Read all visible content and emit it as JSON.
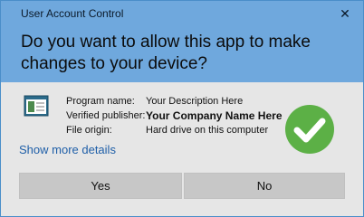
{
  "window": {
    "title": "User Account Control",
    "close_icon": "close-icon"
  },
  "prompt": {
    "headline": "Do you want to allow this app to make changes to your device?"
  },
  "details": {
    "program_label": "Program name:",
    "program_value": "Your Description Here",
    "publisher_label": "Verified publisher:",
    "publisher_value": "Your Company Name Here",
    "origin_label": "File origin:",
    "origin_value": "Hard drive on this computer",
    "app_icon": "app-window-icon",
    "verified_icon": "checkmark-icon"
  },
  "links": {
    "show_more": "Show more details"
  },
  "buttons": {
    "yes": "Yes",
    "no": "No"
  },
  "colors": {
    "header": "#6fa8dd",
    "body": "#e6e6e6",
    "link": "#1f5fa8",
    "check": "#5cb046"
  }
}
